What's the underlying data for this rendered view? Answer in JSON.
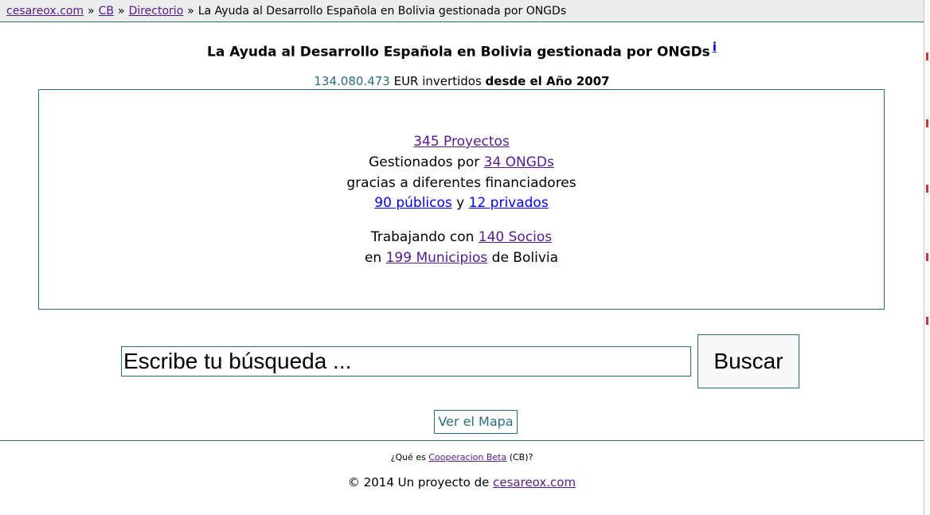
{
  "breadcrumb": {
    "items": [
      "cesareox.com",
      "CB",
      "Directorio"
    ],
    "separator": "»",
    "current": "La Ayuda al Desarrollo Española en Bolivia gestionada por ONGDs"
  },
  "title": {
    "text": "La Ayuda al Desarrollo Española en Bolivia gestionada por ONGDs",
    "info_icon": "i"
  },
  "investment": {
    "amount": "134.080.473",
    "middle": " EUR invertidos ",
    "since": "desde el Año 2007"
  },
  "stats": {
    "projects_link": "345 Proyectos",
    "managed_prefix": "Gestionados por ",
    "ongds_link": "34 ONGDs",
    "funders_text": "gracias a diferentes financiadores",
    "public_link": "90 públicos",
    "and_text": " y ",
    "private_link": "12 privados",
    "partners_prefix": "Trabajando con ",
    "partners_link": "140 Socios",
    "municipalities_prefix": "en ",
    "municipalities_link": "199 Municipios",
    "municipalities_suffix": " de Bolivia"
  },
  "search": {
    "placeholder": "Escribe tu búsqueda ...",
    "button_label": "Buscar"
  },
  "map_button": "Ver el Mapa",
  "footer": {
    "whatis_prefix": "¿Qué es ",
    "whatis_link": "Cooperacion Beta",
    "whatis_suffix": " (CB)?",
    "copyright_prefix": "© 2014 Un proyecto de ",
    "copyright_link": "cesareox.com"
  },
  "colors": {
    "accent": "#2b6d7f",
    "visited_link": "#551a8b",
    "link": "#0000ee"
  }
}
